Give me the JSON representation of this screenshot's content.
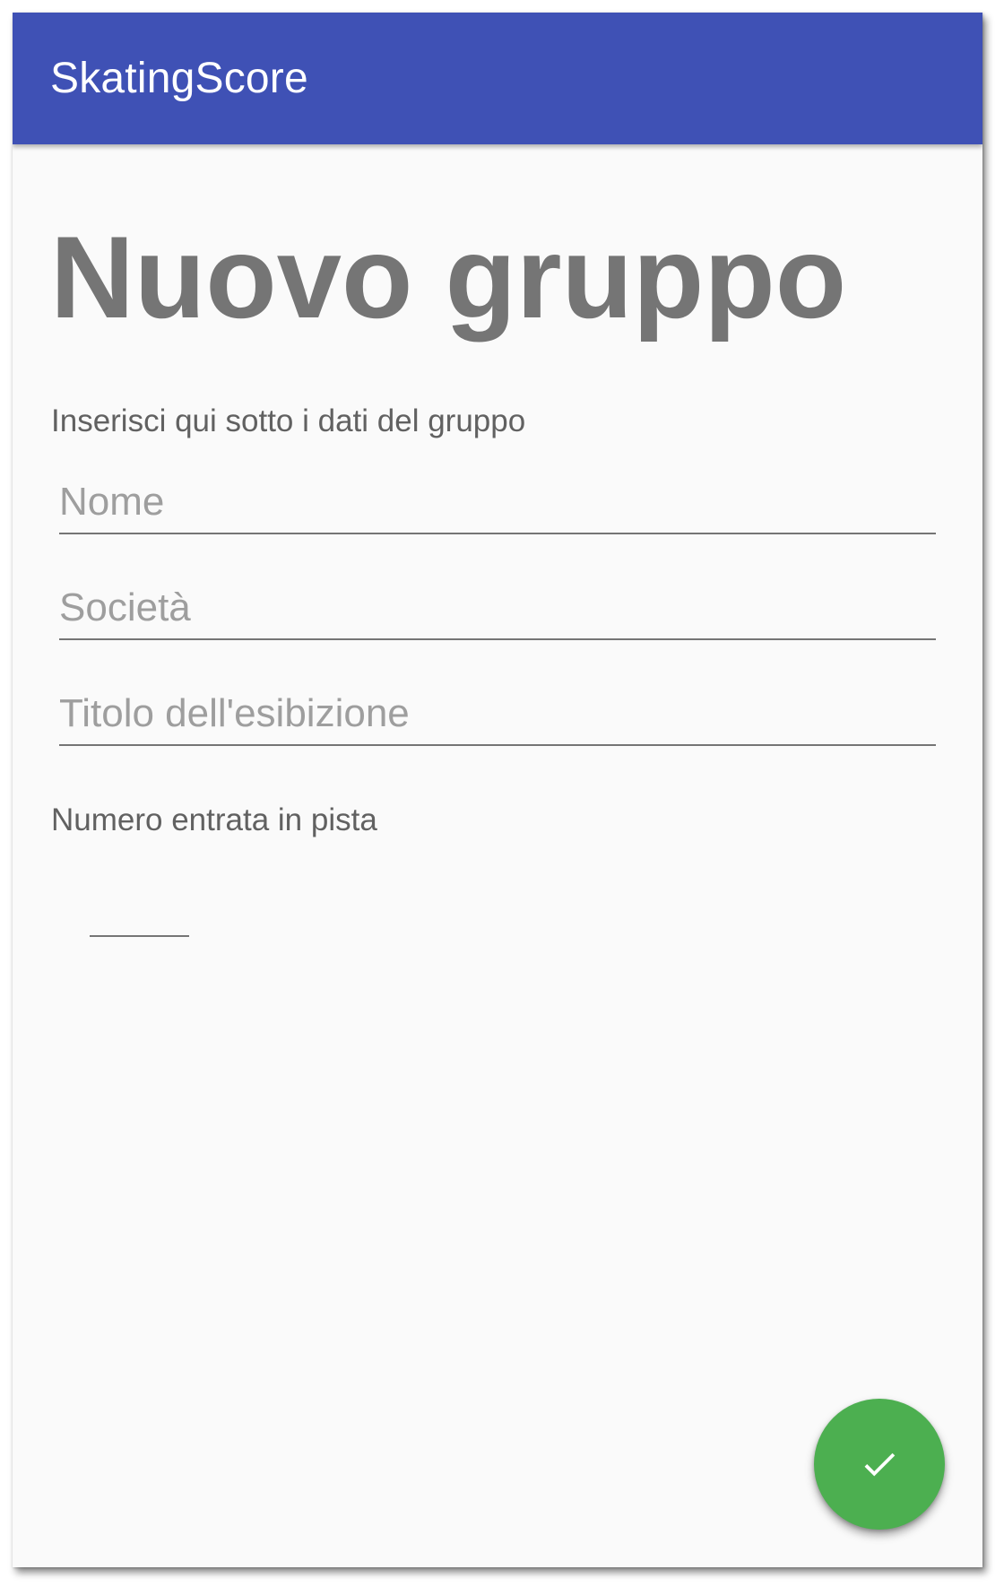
{
  "app": {
    "title": "SkatingScore",
    "primary_color": "#3f51b5",
    "accent_color": "#4caf50"
  },
  "main": {
    "heading": "Nuovo gruppo",
    "subtitle": "Inserisci qui sotto i dati del gruppo",
    "fields": {
      "nome": {
        "value": "",
        "placeholder": "Nome"
      },
      "societa": {
        "value": "",
        "placeholder": "Società"
      },
      "titolo": {
        "value": "",
        "placeholder": "Titolo dell'esibizione"
      }
    },
    "numero_label": "Numero entrata in pista",
    "numero_value": ""
  },
  "fab": {
    "icon": "check-icon"
  }
}
